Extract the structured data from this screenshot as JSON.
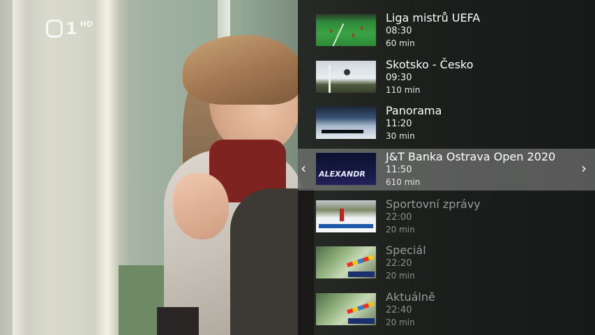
{
  "channel": {
    "number": "1",
    "quality": "HD"
  },
  "programs": [
    {
      "title": "Liga mistrů UEFA",
      "time": "08:30",
      "duration": "60 min",
      "state": "past"
    },
    {
      "title": "Skotsko - Česko",
      "time": "09:30",
      "duration": "110 min",
      "state": "past"
    },
    {
      "title": "Panorama",
      "time": "11:20",
      "duration": "30 min",
      "state": "past"
    },
    {
      "title": "J&T Banka Ostrava Open 2020",
      "time": "11:50",
      "duration": "610 min",
      "state": "selected",
      "thumbnail_text": "ALEXANDR"
    },
    {
      "title": "Sportovní zprávy",
      "time": "22:00",
      "duration": "20 min",
      "state": "future"
    },
    {
      "title": "Speciál",
      "time": "22:20",
      "duration": "20 min",
      "state": "future"
    },
    {
      "title": "Aktuálně",
      "time": "22:40",
      "duration": "20 min",
      "state": "future"
    }
  ],
  "nav": {
    "prev_icon": "chevron-left-icon",
    "next_icon": "chevron-right-icon",
    "prev_glyph": "‹",
    "next_glyph": "›"
  }
}
